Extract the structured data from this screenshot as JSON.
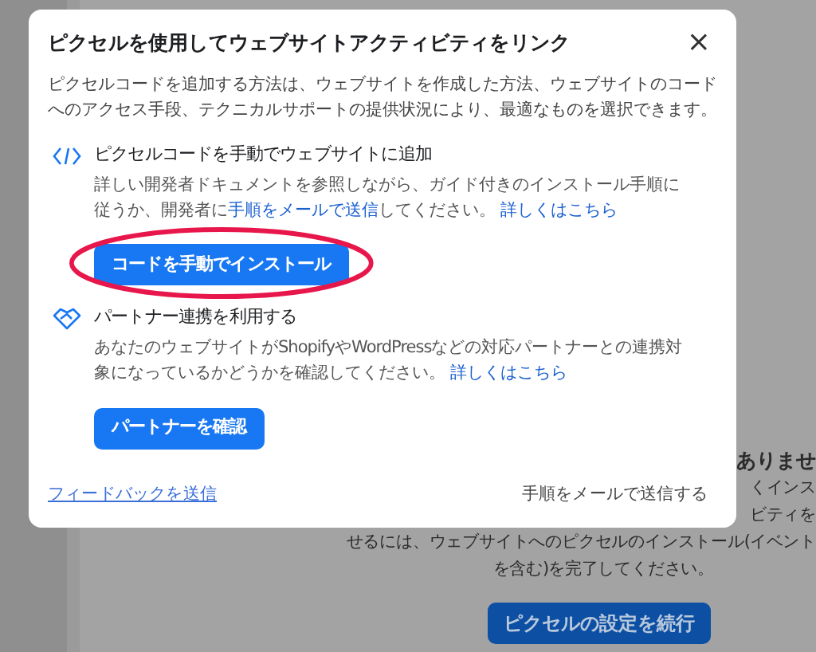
{
  "background": {
    "heading": "ありませ",
    "lines": [
      "くインス",
      "ビティを",
      "せるには、ウェブサイトへのピクセルのインストール(イベント",
      "を含む)を完了してください。"
    ],
    "button": "ピクセルの設定を続行"
  },
  "dialog": {
    "title": "ピクセルを使用してウェブサイトアクティビティをリンク",
    "close": "×",
    "intro": "ピクセルコードを追加する方法は、ウェブサイトを作成した方法、ウェブサイトのコードへのアクセス手段、テクニカルサポートの提供状況により、最適なものを選択できます。",
    "options": [
      {
        "kind": "code",
        "title": "ピクセルコードを手動でウェブサイトに追加",
        "text_before": "詳しい開発者ドキュメントを参照しながら、ガイド付きのインストール手順に従うか、開発者に",
        "inline_link": "手順をメールで送信",
        "text_after": "してください。",
        "more_link": "詳しくはこちら",
        "button": "コードを手動でインストール",
        "highlighted": true
      },
      {
        "kind": "partner",
        "title": "パートナー連携を利用する",
        "text_before": "あなたのウェブサイトがShopifyやWordPressなどの対応パートナーとの連携対象になっているかどうかを確認してください。",
        "more_link": "詳しくはこちら",
        "button": "パートナーを確認",
        "highlighted": false
      }
    ],
    "feedback_link": "フィードバックを送信",
    "email_button": "手順をメールで送信する"
  }
}
